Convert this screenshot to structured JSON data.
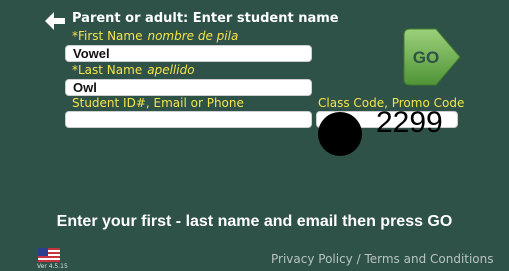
{
  "header": {
    "title": "Parent or adult: Enter student name",
    "back_icon": "left-arrow-icon"
  },
  "form": {
    "first_name": {
      "label": "*First Name",
      "label_es": "nombre de pila",
      "value": "Vowel"
    },
    "last_name": {
      "label": "*Last Name",
      "label_es": "apellido",
      "value": "Owl"
    },
    "student_id": {
      "label": "Student ID#, Email or Phone",
      "value": ""
    },
    "class_code": {
      "label": "Class Code, Promo Code",
      "value": ""
    }
  },
  "go_button": {
    "label": "GO"
  },
  "overlay": {
    "code_text": "2299"
  },
  "instruction": "Enter your first - last name and email then press GO",
  "footer": {
    "version": "Ver 4.5.15",
    "links": "Privacy Policy / Terms and Conditions",
    "flag_icon": "us-flag-icon"
  },
  "colors": {
    "background": "#2f5248",
    "label": "#f4e34a",
    "go_green_top": "#9cd07a",
    "go_green_bottom": "#4f9437",
    "go_text": "#2f5248"
  }
}
